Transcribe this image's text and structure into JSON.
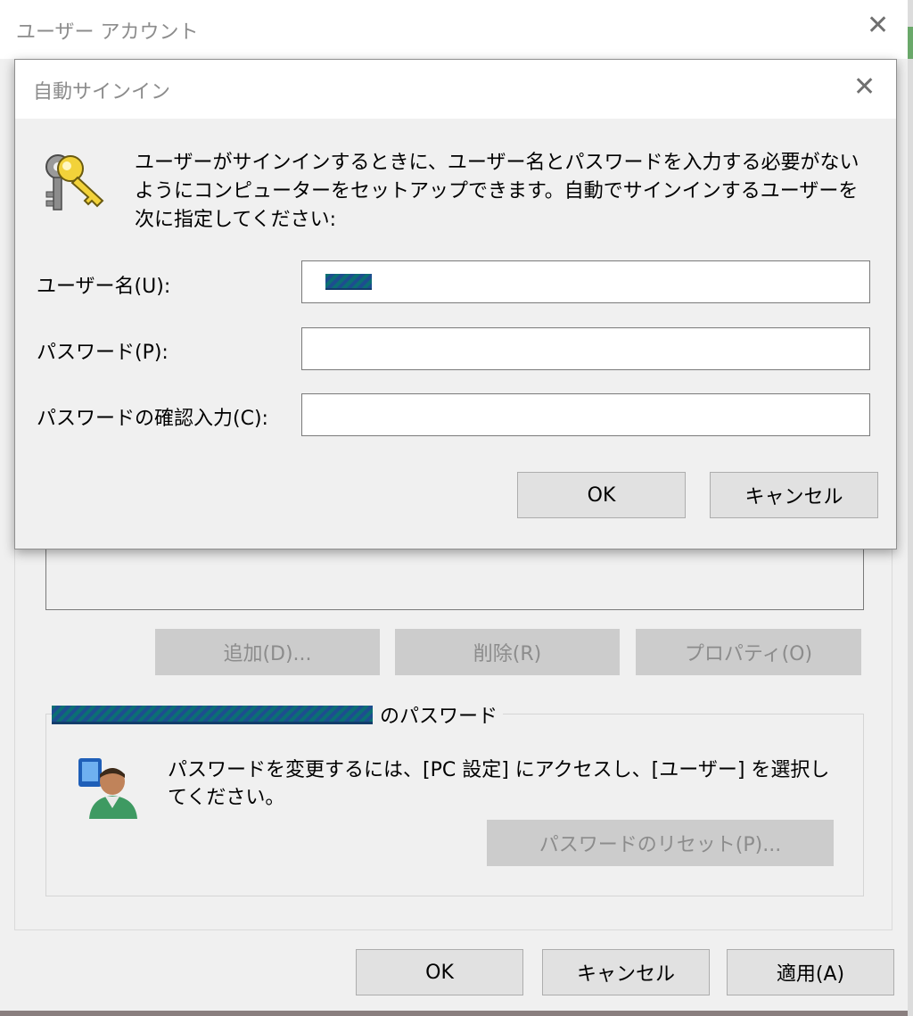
{
  "outer_window": {
    "title": "ユーザー アカウント",
    "close_glyph": "✕",
    "buttons": {
      "add": "追加(D)...",
      "remove": "削除(R)",
      "properties": "プロパティ(O)"
    },
    "password_group": {
      "legend_suffix": "のパスワード",
      "text": "パスワードを変更するには、[PC 設定] にアクセスし、[ユーザー] を選択してください。",
      "reset_button": "パスワードのリセット(P)...",
      "icon": "user-icon"
    },
    "footer": {
      "ok": "OK",
      "cancel": "キャンセル",
      "apply": "適用(A)"
    }
  },
  "dialog": {
    "title": "自動サインイン",
    "close_glyph": "✕",
    "icon": "keys-icon",
    "description": "ユーザーがサインインするときに、ユーザー名とパスワードを入力する必要がないようにコンピューターをセットアップできます。自動でサインインするユーザーを次に指定してください:",
    "fields": {
      "username_label": "ユーザー名(U):",
      "password_label": "パスワード(P):",
      "confirm_label": "パスワードの確認入力(C):"
    },
    "buttons": {
      "ok": "OK",
      "cancel": "キャンセル"
    }
  }
}
